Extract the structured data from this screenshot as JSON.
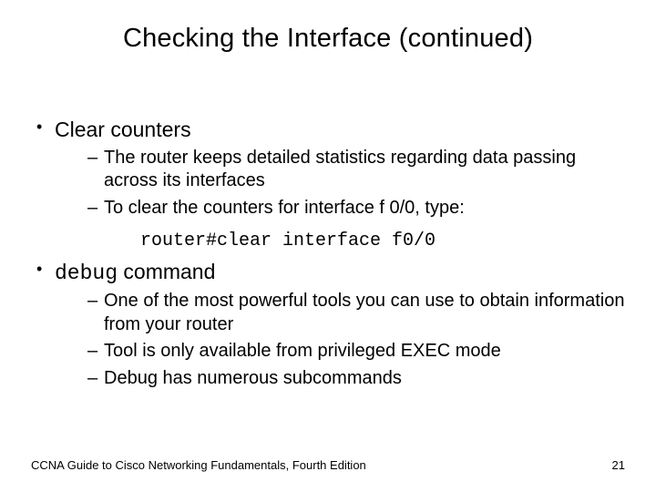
{
  "title": "Checking the Interface (continued)",
  "bullets": {
    "b1": {
      "label": "Clear counters"
    },
    "b1_sub": {
      "s1": "The router keeps detailed statistics regarding data passing across its interfaces",
      "s2": "To clear the counters for interface f 0/0, type:"
    },
    "b1_code": "router#clear interface f0/0",
    "b2": {
      "code_word": "debug",
      "rest": " command"
    },
    "b2_sub": {
      "s1": "One of the most powerful tools you can use to obtain information from your router",
      "s2": "Tool is only available from privileged EXEC mode",
      "s3": "Debug has numerous subcommands"
    }
  },
  "footer": {
    "left": "CCNA Guide to Cisco Networking Fundamentals, Fourth Edition",
    "page": "21"
  }
}
